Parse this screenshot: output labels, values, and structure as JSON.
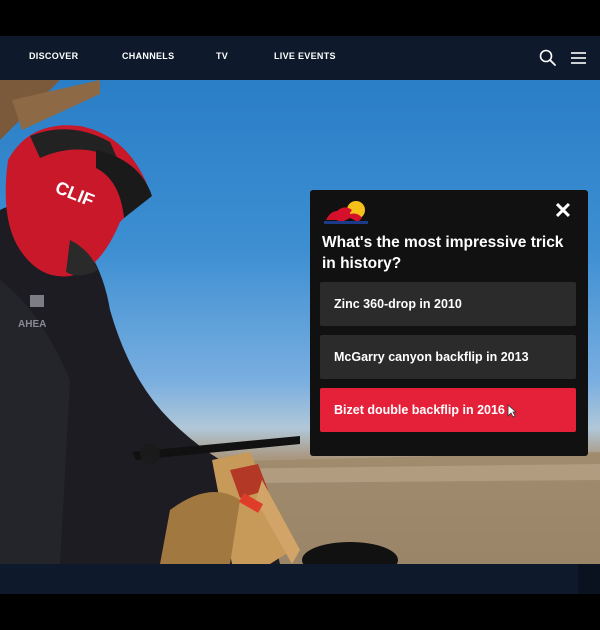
{
  "nav": {
    "links": [
      "DISCOVER",
      "CHANNELS",
      "TV",
      "LIVE EVENTS"
    ],
    "icons": [
      "search-icon",
      "menu-icon"
    ]
  },
  "video": {
    "helmet_brand": "CLIF"
  },
  "poll": {
    "logo": "red-bull-logo",
    "question": "What's the most impressive trick in history?",
    "options": [
      "Zinc 360-drop in 2010",
      "McGarry canyon backflip in 2013",
      "Bizet double backflip in 2016"
    ],
    "selected_option": "Bizet double backflip in 2016",
    "colors": {
      "panel": "#111111",
      "option": "#2b2b2b",
      "selected": "#e5213a"
    }
  },
  "colors": {
    "navbar": "#0e1a2b"
  }
}
